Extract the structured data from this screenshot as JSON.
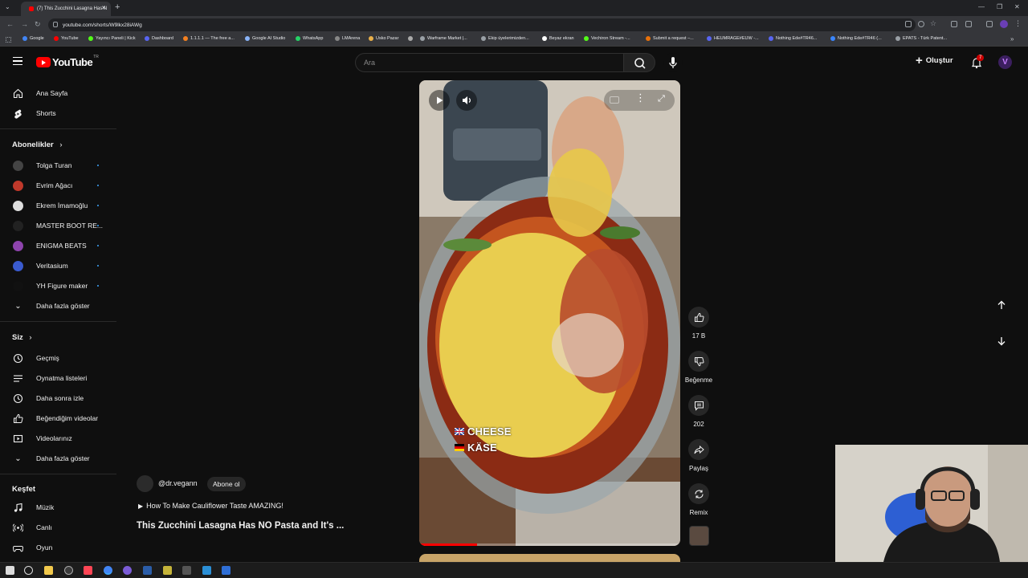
{
  "browser": {
    "tab_title": "(7) This Zucchini Lasagna Has N",
    "url": "youtube.com/shorts/W9lkx28iAWg",
    "bookmarks": [
      {
        "label": "Google",
        "color": "#4285f4"
      },
      {
        "label": "YouTube",
        "color": "#ff0000"
      },
      {
        "label": "Yayıncı Paneli | Kick",
        "color": "#53fc18"
      },
      {
        "label": "Dashboard",
        "color": "#5865f2"
      },
      {
        "label": "1.1.1.1 — The free a...",
        "color": "#f38020"
      },
      {
        "label": "Google AI Studio",
        "color": "#8ab4f8"
      },
      {
        "label": "WhatsApp",
        "color": "#25d366"
      },
      {
        "label": "LMArena",
        "color": "#888888"
      },
      {
        "label": "Usko Pazar",
        "color": "#e8b04a"
      },
      {
        "label": "",
        "color": "#aaaaaa"
      },
      {
        "label": "Warframe Market |...",
        "color": "#9aa0a6"
      },
      {
        "label": "Ekip üyelerimizden...",
        "color": "#9aa0a6"
      },
      {
        "label": "Beyaz ekran",
        "color": "#ffffff"
      },
      {
        "label": "Vechiron Stream -...",
        "color": "#53fc18"
      },
      {
        "label": "Submit a request –...",
        "color": "#e8710a"
      },
      {
        "label": "HEUMRAGE#EUW -...",
        "color": "#5865f2"
      },
      {
        "label": "Nothing Ede#TR46...",
        "color": "#5865f2"
      },
      {
        "label": "Nothing Ede#TR46 (...",
        "color": "#3a86ff"
      },
      {
        "label": "EPATS - Türk Patent...",
        "color": "#9aa0a6"
      }
    ]
  },
  "header": {
    "logo_text": "YouTube",
    "logo_country": "TR",
    "search_placeholder": "Ara",
    "create_label": "Oluştur",
    "notification_count": "7",
    "avatar_letter": "V"
  },
  "sidebar": {
    "main": [
      {
        "label": "Ana Sayfa",
        "icon": "home-icon"
      },
      {
        "label": "Shorts",
        "icon": "shorts-icon"
      }
    ],
    "subs_title": "Abonelikler",
    "subs": [
      {
        "label": "Tolga Turan",
        "color": "#444444"
      },
      {
        "label": "Evrim Ağacı",
        "color": "#c0392b"
      },
      {
        "label": "Ekrem İmamoğlu",
        "color": "#dddddd"
      },
      {
        "label": "MASTER BOOT RE...",
        "color": "#222222"
      },
      {
        "label": "ENIGMA BEATS",
        "color": "#8e44ad"
      },
      {
        "label": "Veritasium",
        "color": "#3a5bcf"
      },
      {
        "label": "YH Figure maker",
        "color": "#111111"
      }
    ],
    "show_more": "Daha fazla göster",
    "you_title": "Siz",
    "you_items": [
      {
        "label": "Geçmiş",
        "icon": "history-icon"
      },
      {
        "label": "Oynatma listeleri",
        "icon": "playlist-icon"
      },
      {
        "label": "Daha sonra izle",
        "icon": "clock-icon"
      },
      {
        "label": "Beğendiğim videolar",
        "icon": "like-icon"
      },
      {
        "label": "Videolarınız",
        "icon": "video-icon"
      }
    ],
    "show_more_2": "Daha fazla göster",
    "explore_title": "Keşfet",
    "explore_items": [
      {
        "label": "Müzik",
        "icon": "music-icon"
      },
      {
        "label": "Canlı",
        "icon": "live-icon"
      },
      {
        "label": "Oyun",
        "icon": "gaming-icon"
      }
    ]
  },
  "short": {
    "overlay_line1": "CHEESE",
    "overlay_line2": "KÄSE",
    "channel": "@dr.vegann",
    "subscribe": "Abone ol",
    "linked_video": "How To Make Cauliflower Taste AMAZING!",
    "title": "This Zucchini Lasagna Has NO Pasta and It's ...",
    "progress": 0.22
  },
  "actions": {
    "likes": "17 B",
    "dislike": "Beğenme",
    "comments": "202",
    "share": "Paylaş",
    "remix": "Remix"
  }
}
